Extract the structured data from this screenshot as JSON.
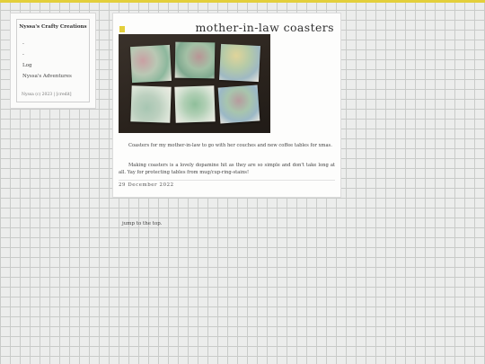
{
  "sidebar": {
    "site_title": "Nyssa's Crafty Creations",
    "nav": [
      {
        "label": "-"
      },
      {
        "label": "-"
      },
      {
        "label": "Log"
      },
      {
        "label": "Nyssa's Adventures"
      }
    ],
    "footer": {
      "copyright": "Nyssa (c) 2023 |",
      "credit": "[credit]"
    }
  },
  "post": {
    "title": "mother-in-law coasters",
    "paragraphs": [
      "Coasters for my mother-in-law to go with her couches and new coffee tables for xmas.",
      "Making coasters is a lovely dopamine hit as they are so simple and don't take long at all. Yay for protecting tables from mug/cup-ring-stains!"
    ],
    "date": "29 December 2022"
  },
  "jump_link": "jump to the top.",
  "colors": {
    "accent": "#e3cf3b",
    "background": "#ecedec",
    "card": "#fdfdfc"
  }
}
